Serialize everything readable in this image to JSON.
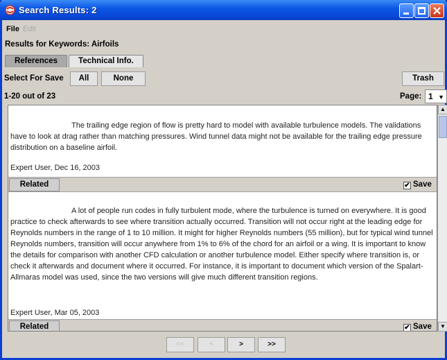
{
  "window": {
    "title": "Search Results:  2",
    "controls": {
      "minimize": "minimize-icon",
      "maximize": "maximize-icon",
      "close": "close-icon"
    }
  },
  "menu": {
    "file": "File",
    "edit": "Edit"
  },
  "results_label": "Results for Keywords: Airfoils",
  "tabs": [
    {
      "label": "References",
      "selected": false
    },
    {
      "label": "Technical Info.",
      "selected": true
    }
  ],
  "toolbar": {
    "select_label": "Select For Save",
    "all": "All",
    "none": "None",
    "trash": "Trash"
  },
  "summary": {
    "count": "1-20 out of 23",
    "page_label": "Page:",
    "page_value": "1"
  },
  "entries": [
    {
      "text": "The trailing edge region of flow is pretty hard to model with available turbulence models.  The validations have to look at drag rather than matching pressures.  Wind tunnel data might not be available for the trailing edge pressure distribution on a baseline airfoil.",
      "author": "Expert User, Dec 16, 2003",
      "related": "Related",
      "save": "Save",
      "saved": true
    },
    {
      "text": "A lot of people run codes in fully turbulent mode, where the turbulence is turned on everywhere.  It is good practice to check afterwards to see where transition actually occurred.  Transition will not occur right at the leading edge for Reynolds numbers in the range of 1 to 10 million.  It might for higher Reynolds numbers (55 million), but for typical wind tunnel Reynolds numbers, transition will occur anywhere from 1% to 6% of the chord for an airfoil or a wing.  It is important to know the details for comparison with another CFD calculation or another turbulence model.   Either specify where transition is, or check it afterwards and document where it occurred.  For instance, it is important to document which version of the Spalart-Allmaras model was used, since the two versions will give much different transition regions.",
      "author": "Expert User, Mar 05, 2003",
      "related": "Related",
      "save": "Save",
      "saved": true
    }
  ],
  "pager": {
    "first": "<<",
    "prev": "<",
    "next": ">",
    "last": ">>"
  },
  "colors": {
    "titlebar": "#0d58e6",
    "close": "#c8351a",
    "panel": "#d4d0c8"
  }
}
